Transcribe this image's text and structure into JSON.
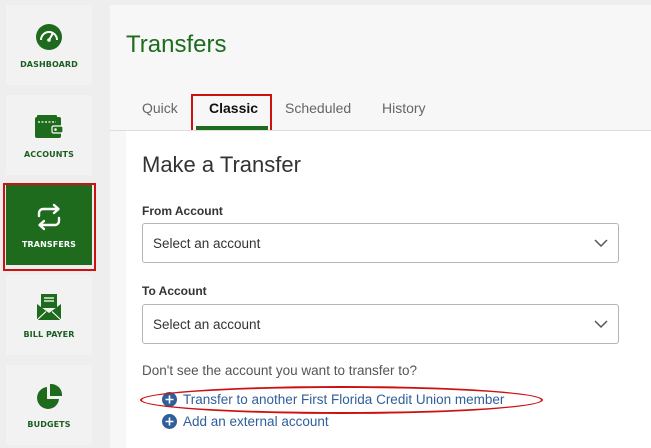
{
  "sidebar": {
    "items": [
      {
        "label": "DASHBOARD",
        "icon": "speedometer-icon",
        "active": false
      },
      {
        "label": "ACCOUNTS",
        "icon": "wallet-icon",
        "active": false
      },
      {
        "label": "TRANSFERS",
        "icon": "transfer-arrows-icon",
        "active": true
      },
      {
        "label": "BILL PAYER",
        "icon": "bill-envelope-icon",
        "active": false
      },
      {
        "label": "BUDGETS",
        "icon": "pie-chart-icon",
        "active": false
      }
    ]
  },
  "header": {
    "title": "Transfers"
  },
  "tabs": [
    {
      "label": "Quick",
      "active": false
    },
    {
      "label": "Classic",
      "active": true
    },
    {
      "label": "Scheduled",
      "active": false
    },
    {
      "label": "History",
      "active": false
    }
  ],
  "form": {
    "title": "Make a Transfer",
    "from_label": "From Account",
    "from_value": "Select an account",
    "to_label": "To Account",
    "to_value": "Select an account",
    "help_text": "Don't see the account you want to transfer to?",
    "links": [
      {
        "label": "Transfer to another First Florida Credit Union member",
        "icon": "plus-circle-icon"
      },
      {
        "label": "Add an external account",
        "icon": "plus-circle-icon"
      }
    ]
  },
  "colors": {
    "brand_green": "#1e6b1e",
    "highlight_red": "#cc1111",
    "link_blue": "#2f5f9a"
  }
}
